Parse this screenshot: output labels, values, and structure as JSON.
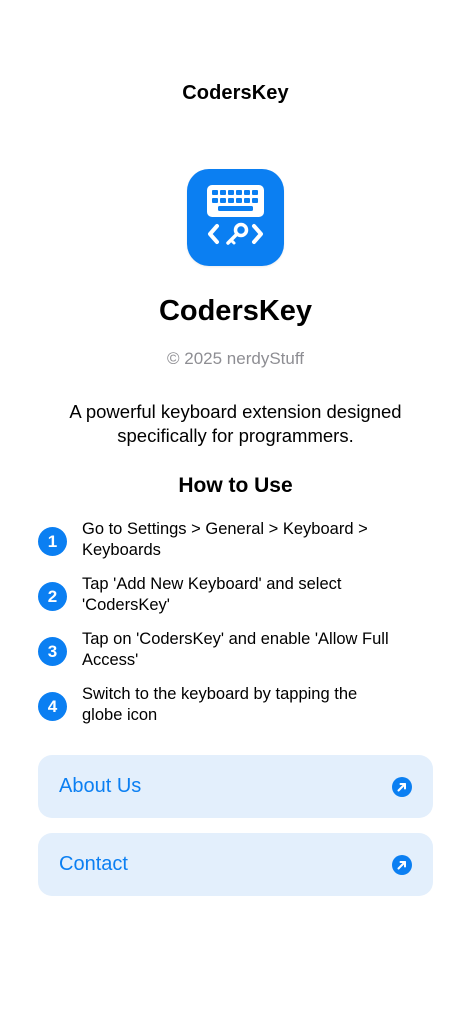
{
  "header": {
    "title": "CodersKey"
  },
  "app": {
    "name": "CodersKey",
    "copyright": "© 2025 nerdyStuff",
    "description": "A powerful keyboard extension designed specifically for programmers.",
    "icon": "keyboard-code-key-icon",
    "accent_color": "#0b7ff2"
  },
  "how_to": {
    "title": "How to Use",
    "steps": [
      {
        "number": "1",
        "text": "Go to Settings > General > Keyboard > Keyboards"
      },
      {
        "number": "2",
        "text": "Tap 'Add New Keyboard' and select 'CodersKey'"
      },
      {
        "number": "3",
        "text": "Tap on 'CodersKey' and enable 'Allow Full Access'"
      },
      {
        "number": "4",
        "text": "Switch to the keyboard by tapping the globe icon"
      }
    ]
  },
  "links": [
    {
      "label": "About Us",
      "icon": "external-arrow-icon"
    },
    {
      "label": "Contact",
      "icon": "external-arrow-icon"
    }
  ]
}
